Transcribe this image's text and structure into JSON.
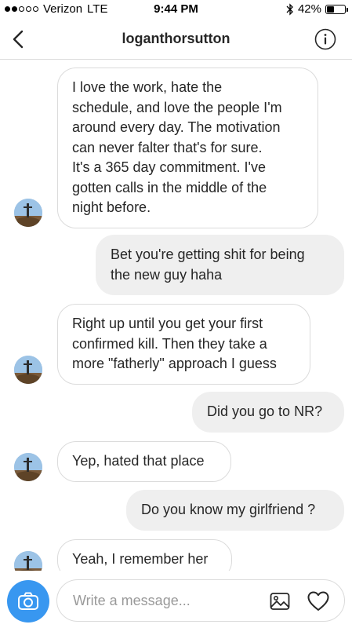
{
  "status_bar": {
    "carrier": "Verizon",
    "network": "LTE",
    "time": "9:44 PM",
    "battery": "42%",
    "battery_level": 0.42,
    "icons": [
      "signal-dots-icon",
      "bluetooth-icon",
      "battery-icon"
    ]
  },
  "header": {
    "title": "loganthorsutton",
    "back_icon": "chevron-left-icon",
    "info_icon": "info-icon"
  },
  "messages": [
    {
      "sender": "them",
      "lines": [
        "I love the work, hate the",
        "schedule, and love the people I'm",
        "around every day. The motivation",
        "can never falter that's for sure.",
        "It's a 365 day commitment. I've",
        "gotten calls in the middle of the",
        "night before."
      ]
    },
    {
      "sender": "me",
      "lines": [
        "Bet you're getting shit for being",
        "the new guy haha"
      ]
    },
    {
      "sender": "them",
      "lines": [
        "Right up until you get your first",
        "confirmed kill. Then they take a",
        "more \"fatherly\" approach I guess"
      ]
    },
    {
      "sender": "me",
      "lines": [
        "Did you go to NR?"
      ]
    },
    {
      "sender": "them",
      "lines": [
        "Yep, hated that place"
      ]
    },
    {
      "sender": "me",
      "lines": [
        "Do you know my girlfriend ?"
      ]
    },
    {
      "sender": "them",
      "lines": [
        "Yeah, I remember her"
      ]
    }
  ],
  "compose": {
    "placeholder": "Write a message...",
    "value": "",
    "camera_icon": "camera-icon",
    "gallery_icon": "image-icon",
    "heart_icon": "heart-icon"
  },
  "colors": {
    "accent": "#3897f0",
    "outgoing_bubble": "#efefef",
    "border": "#dbdbdb",
    "text": "#262626",
    "placeholder": "#999999"
  }
}
